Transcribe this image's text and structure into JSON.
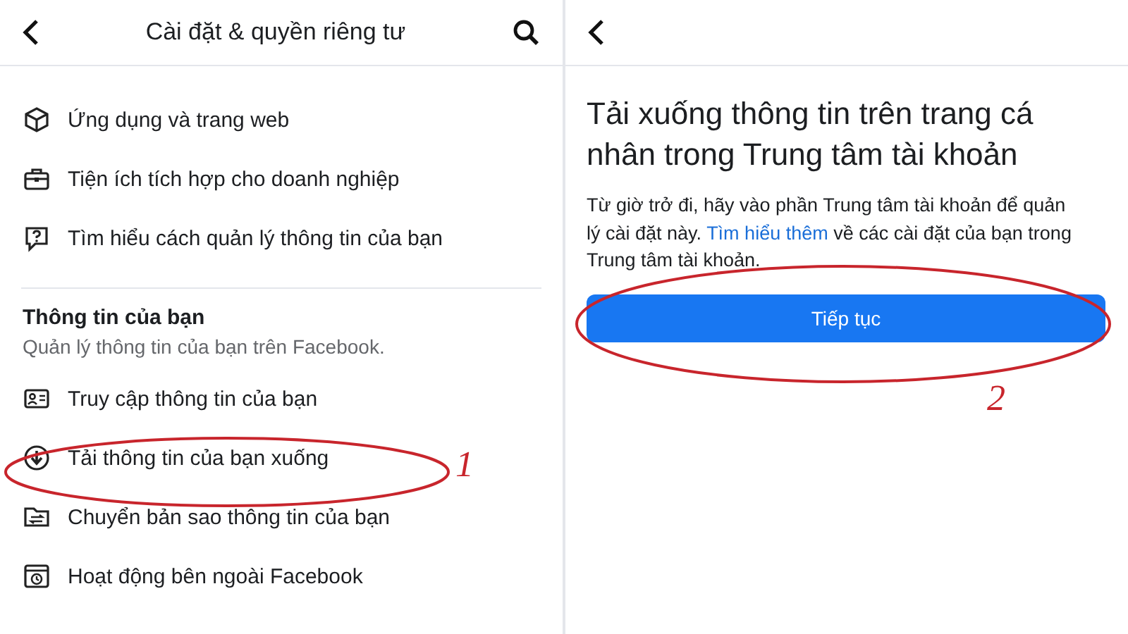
{
  "left_screen": {
    "header": {
      "title": "Cài đặt & quyền riêng tư"
    },
    "items": [
      {
        "label": "Ứng dụng và trang web"
      },
      {
        "label": "Tiện ích tích hợp cho doanh nghiệp"
      },
      {
        "label": "Tìm hiểu cách quản lý thông tin của bạn"
      }
    ],
    "section": {
      "title": "Thông tin của bạn",
      "subtitle": "Quản lý thông tin của bạn trên Facebook.",
      "items": [
        {
          "label": "Truy cập thông tin của bạn"
        },
        {
          "label": "Tải thông tin của bạn xuống"
        },
        {
          "label": "Chuyển bản sao thông tin của bạn"
        },
        {
          "label": "Hoạt động bên ngoài Facebook"
        }
      ]
    }
  },
  "right_screen": {
    "title": "Tải xuống thông tin trên trang cá nhân trong Trung tâm tài khoản",
    "paragraph": {
      "before": "Từ giờ trở đi, hãy vào phần Trung tâm tài khoản để quản lý cài đặt này. ",
      "link": "Tìm hiểu thêm",
      "after": " về các cài đặt của bạn trong Trung tâm tài khoản."
    },
    "button": "Tiếp tục"
  },
  "annotations": [
    {
      "label": "1"
    },
    {
      "label": "2"
    }
  ]
}
